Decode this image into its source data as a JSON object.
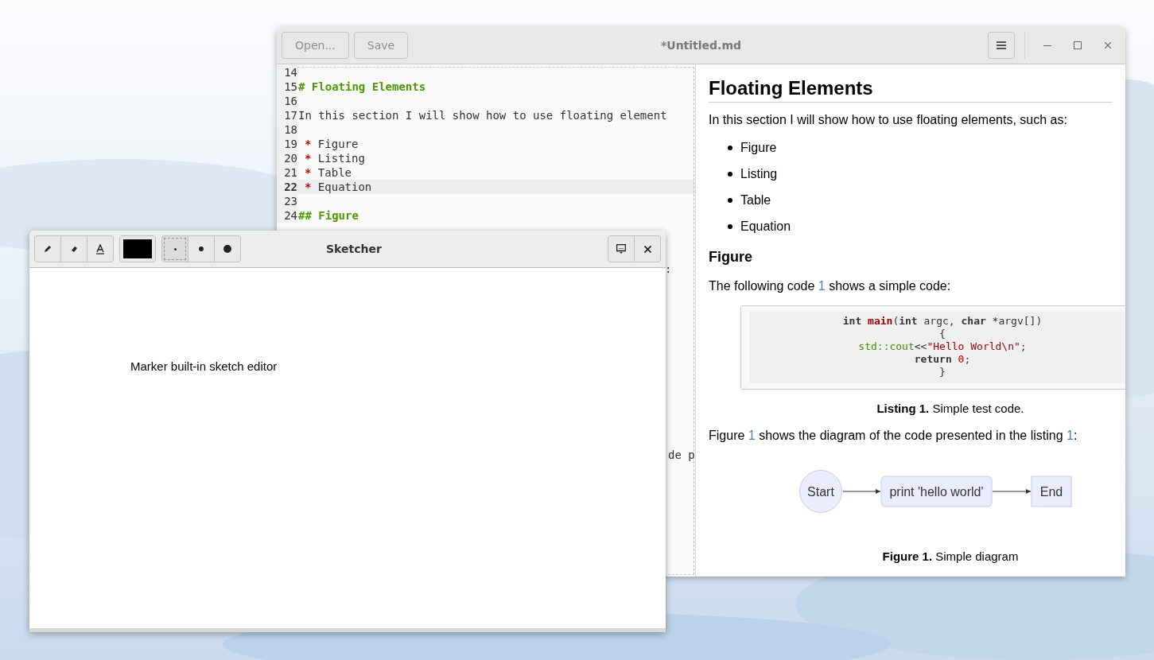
{
  "editor_window": {
    "title": "*Untitled.md",
    "header_buttons": [
      {
        "label": "Open...",
        "disabled": true
      },
      {
        "label": "Save",
        "disabled": true
      }
    ],
    "code_lines": [
      {
        "number": "14",
        "kind": "plain",
        "current": false
      },
      {
        "number": "15",
        "kind": "heading",
        "text": "# Floating Elements",
        "current": false
      },
      {
        "number": "16",
        "kind": "plain",
        "current": false
      },
      {
        "number": "17",
        "kind": "plain",
        "text": "In this section I will show how to use floating element",
        "current": false
      },
      {
        "number": "18",
        "kind": "plain",
        "current": false
      },
      {
        "number": "19",
        "kind": "bullet",
        "marker": "*",
        "text": "Figure",
        "current": false
      },
      {
        "number": "20",
        "kind": "bullet",
        "marker": "*",
        "text": "Listing",
        "current": false
      },
      {
        "number": "21",
        "kind": "bullet",
        "marker": "*",
        "text": "Table",
        "current": false
      },
      {
        "number": "22",
        "kind": "bullet",
        "marker": "*",
        "text": "Equation",
        "current": true
      },
      {
        "number": "23",
        "kind": "plain",
        "current": false
      },
      {
        "number": "24",
        "kind": "heading",
        "text": "## Figure",
        "current": false
      }
    ],
    "clipped_fragments": [
      {
        "text": ":"
      },
      {
        "text": "de p"
      }
    ],
    "preview": {
      "heading": "Floating Elements",
      "intro": "In this section I will show how to use floating elements, such as:",
      "bullets": [
        "Figure",
        "Listing",
        "Table",
        "Equation"
      ],
      "subheading": "Figure",
      "listing_ref": [
        {
          "text": "The following code "
        },
        {
          "text": "1",
          "kind": "link"
        },
        {
          "text": " shows a simple code:"
        }
      ],
      "code_block": [
        [
          {
            "kind": "keyword",
            "text": "int "
          },
          {
            "kind": "function",
            "text": "main"
          },
          {
            "kind": "plain",
            "text": "("
          },
          {
            "kind": "keyword",
            "text": "int"
          },
          {
            "kind": "plain",
            "text": " argc, "
          },
          {
            "kind": "keyword",
            "text": "char"
          },
          {
            "kind": "plain",
            "text": " *argv[])"
          }
        ],
        [
          {
            "kind": "plain",
            "text": "{"
          }
        ],
        [
          {
            "kind": "namespace",
            "text": "std::cout"
          },
          {
            "kind": "plain",
            "text": "<<"
          },
          {
            "kind": "string",
            "text": "\"Hello World\\n\""
          },
          {
            "kind": "plain",
            "text": ";"
          }
        ],
        [
          {
            "kind": "keyword",
            "text": "return "
          },
          {
            "kind": "number",
            "text": "0"
          },
          {
            "kind": "plain",
            "text": ";"
          }
        ],
        [
          {
            "kind": "plain",
            "text": "}"
          }
        ]
      ],
      "listing_caption": "**Listing 1.** Simple test code.",
      "figure_ref": [
        {
          "text": "Figure "
        },
        {
          "text": "1",
          "kind": "link"
        },
        {
          "text": " shows the diagram of the code presented in the listing "
        },
        {
          "text": "1",
          "kind": "link"
        },
        {
          "text": ":"
        }
      ],
      "diagram_nodes": [
        {
          "kind": "circle",
          "label": "Start"
        },
        {
          "kind": "rounded",
          "label": "print 'hello world'"
        },
        {
          "kind": "square",
          "label": "End"
        }
      ],
      "figure_caption": "**Figure 1.** Simple diagram"
    }
  },
  "sketcher_window": {
    "title": "Sketcher",
    "tools": [
      {
        "kind": "pencil"
      },
      {
        "kind": "eraser"
      },
      {
        "kind": "text"
      }
    ],
    "color": "#000000",
    "brush_sizes": [
      {
        "kind": "small",
        "selected": true
      },
      {
        "kind": "medium",
        "selected": false
      },
      {
        "kind": "large",
        "selected": false
      }
    ],
    "canvas_text": "Marker built-in sketch editor"
  }
}
